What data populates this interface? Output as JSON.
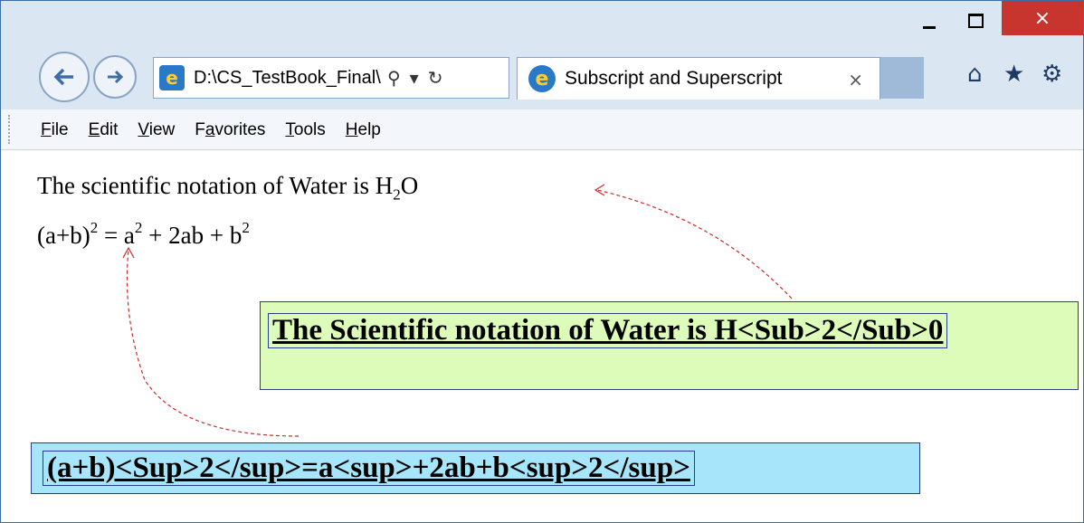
{
  "window": {
    "controls": {
      "minimize_icon": "minimize-icon",
      "maximize_icon": "maximize-icon",
      "close_symbol": "×"
    }
  },
  "nav": {
    "back_icon": "back-arrow-icon",
    "forward_icon": "forward-arrow-icon",
    "address_value": "D:\\CS_TestBook_Final\\",
    "address_search_symbol": "⚲",
    "address_dropdown_symbol": "▾",
    "address_refresh_symbol": "↻"
  },
  "tab": {
    "title": "Subscript and Superscript",
    "close_symbol": "×"
  },
  "toolbar": {
    "home_symbol": "⌂",
    "favorites_symbol": "★",
    "settings_symbol": "⚙"
  },
  "menu": {
    "items": [
      {
        "first": "F",
        "rest": "ile"
      },
      {
        "first": "E",
        "rest": "dit"
      },
      {
        "first": "V",
        "rest": "iew"
      },
      {
        "pre": "F",
        "first": "a",
        "rest": "vorites"
      },
      {
        "first": "T",
        "rest": "ools"
      },
      {
        "first": "H",
        "rest": "elp"
      }
    ]
  },
  "page": {
    "line1_text": "The scientific notation of Water is H",
    "line1_sub": "2",
    "line1_tail": "O",
    "line2_part1": "(a+b)",
    "line2_sup1": "2",
    "line2_part2": " = a",
    "line2_sup2": "2",
    "line2_part3": " + 2ab + b",
    "line2_sup3": "2"
  },
  "annotations": {
    "box1_text": "The Scientific notation of Water is H<Sub>2</Sub>0",
    "box2_text": "(a+b)<Sup>2</sup>=a<sup>+2ab+b<sup>2</sup>",
    "arrow_color": "#cc2a2a",
    "box1_bg": "#ddfbb9",
    "box2_bg": "#a7e5fb"
  }
}
